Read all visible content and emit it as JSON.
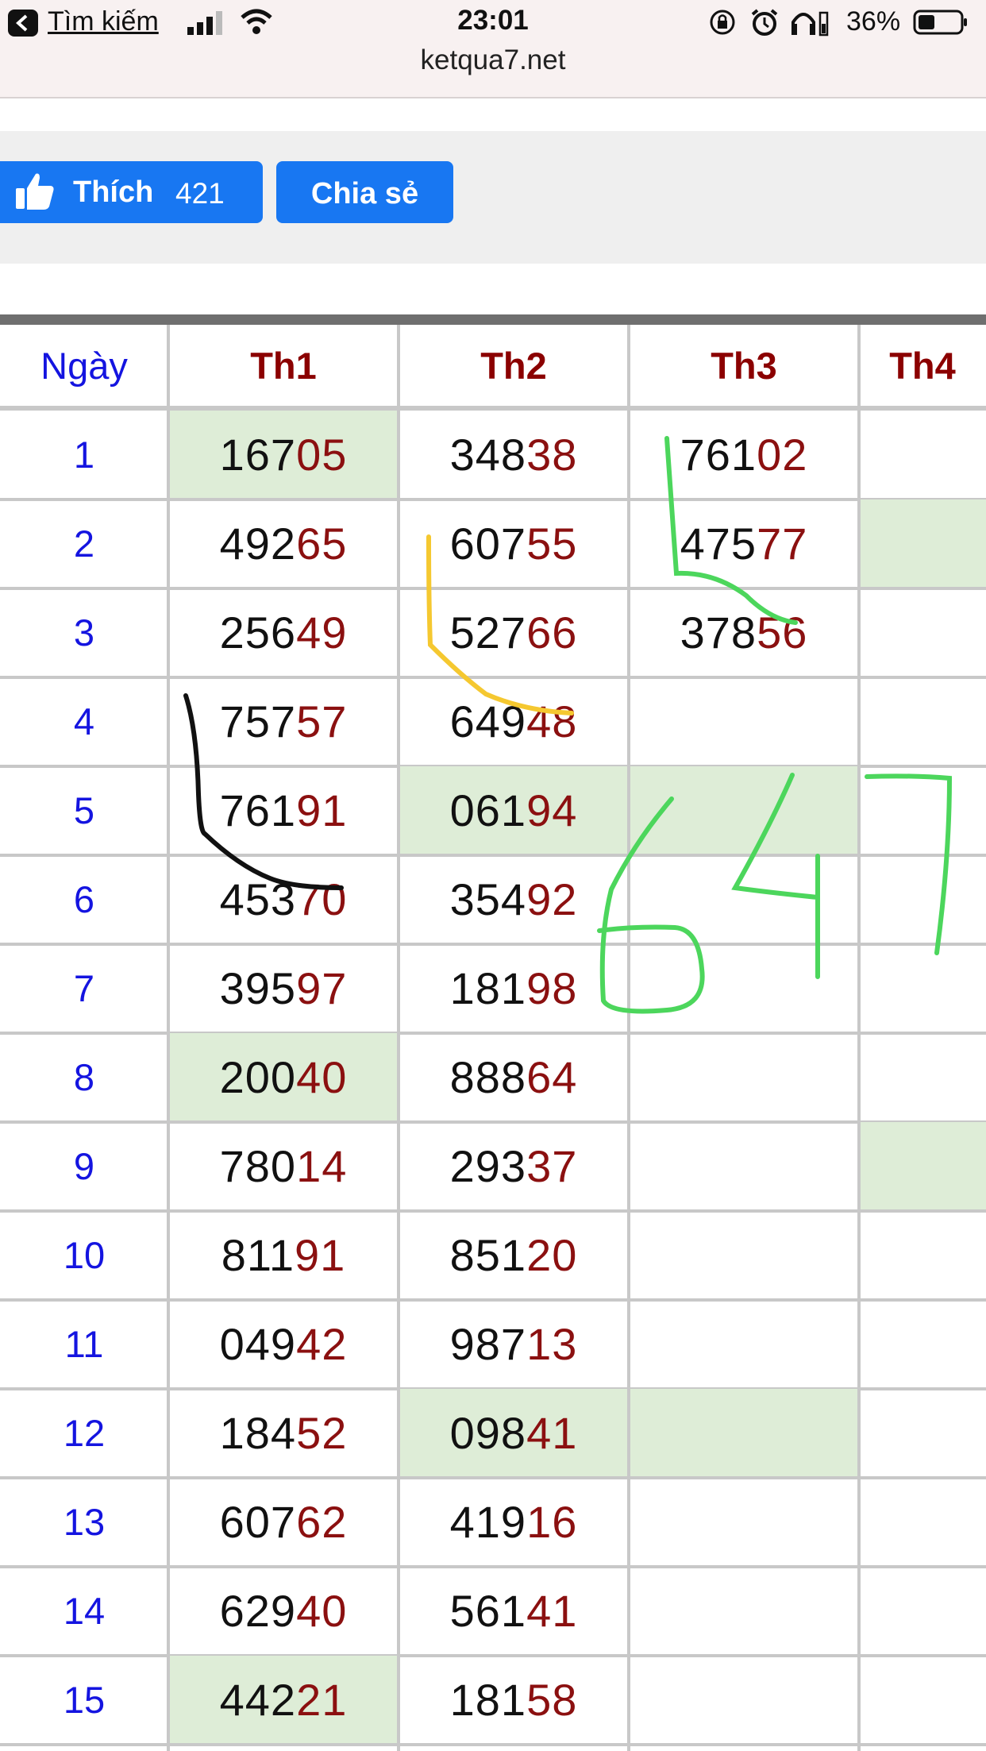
{
  "status_bar": {
    "back_label": "Tìm kiếm",
    "time": "23:01",
    "battery": "36%",
    "url": "ketqua7.net"
  },
  "social": {
    "like_label": "Thích",
    "like_count": "421",
    "share_label": "Chia sẻ"
  },
  "table": {
    "headers": [
      "Ngày",
      "Th1",
      "Th2",
      "Th3",
      "Th4"
    ],
    "rows": [
      {
        "day": "1",
        "th1": [
          "167",
          "05"
        ],
        "th2": [
          "348",
          "38"
        ],
        "th3": [
          "761",
          "02"
        ]
      },
      {
        "day": "2",
        "th1": [
          "492",
          "65"
        ],
        "th2": [
          "607",
          "55"
        ],
        "th3": [
          "475",
          "77"
        ]
      },
      {
        "day": "3",
        "th1": [
          "256",
          "49"
        ],
        "th2": [
          "527",
          "66"
        ],
        "th3": [
          "378",
          "56"
        ]
      },
      {
        "day": "4",
        "th1": [
          "757",
          "57"
        ],
        "th2": [
          "649",
          "48"
        ],
        "th3": null
      },
      {
        "day": "5",
        "th1": [
          "761",
          "91"
        ],
        "th2": [
          "061",
          "94"
        ],
        "th3": null
      },
      {
        "day": "6",
        "th1": [
          "453",
          "70"
        ],
        "th2": [
          "354",
          "92"
        ],
        "th3": null
      },
      {
        "day": "7",
        "th1": [
          "395",
          "97"
        ],
        "th2": [
          "181",
          "98"
        ],
        "th3": null
      },
      {
        "day": "8",
        "th1": [
          "200",
          "40"
        ],
        "th2": [
          "888",
          "64"
        ],
        "th3": null
      },
      {
        "day": "9",
        "th1": [
          "780",
          "14"
        ],
        "th2": [
          "293",
          "37"
        ],
        "th3": null
      },
      {
        "day": "10",
        "th1": [
          "811",
          "91"
        ],
        "th2": [
          "851",
          "20"
        ],
        "th3": null
      },
      {
        "day": "11",
        "th1": [
          "049",
          "42"
        ],
        "th2": [
          "987",
          "13"
        ],
        "th3": null
      },
      {
        "day": "12",
        "th1": [
          "184",
          "52"
        ],
        "th2": [
          "098",
          "41"
        ],
        "th3": null
      },
      {
        "day": "13",
        "th1": [
          "607",
          "62"
        ],
        "th2": [
          "419",
          "16"
        ],
        "th3": null
      },
      {
        "day": "14",
        "th1": [
          "629",
          "40"
        ],
        "th2": [
          "561",
          "41"
        ],
        "th3": null
      },
      {
        "day": "15",
        "th1": [
          "442",
          "21"
        ],
        "th2": [
          "181",
          "58"
        ],
        "th3": null
      }
    ]
  },
  "annotation": {
    "handwritten_number": "647",
    "colors": {
      "green": "#4cd65c",
      "yellow": "#f5c830",
      "black": "#111111"
    }
  },
  "theme": {
    "accent": "#1877f2",
    "day_color": "#1414e0",
    "header_color": "#8b0000",
    "highlight": "#deedd7"
  }
}
